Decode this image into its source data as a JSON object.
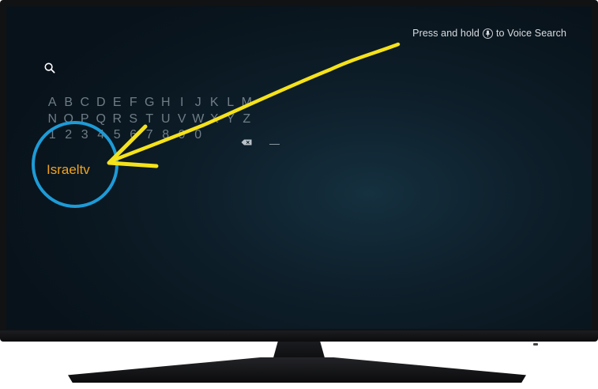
{
  "screen": {
    "voice_hint_prefix": "Press and hold",
    "voice_hint_suffix": "to Voice Search",
    "search_query": "Israeltv"
  },
  "keyboard": {
    "row1": [
      "A",
      "B",
      "C",
      "D",
      "E",
      "F",
      "G",
      "H",
      "I",
      "J",
      "K",
      "L",
      "M"
    ],
    "row2": [
      "N",
      "O",
      "P",
      "Q",
      "R",
      "S",
      "T",
      "U",
      "V",
      "W",
      "X",
      "Y",
      "Z"
    ],
    "row3": [
      "1",
      "2",
      "3",
      "4",
      "5",
      "6",
      "7",
      "8",
      "9",
      "0"
    ]
  },
  "icons": {
    "search": "search-icon",
    "mic": "mic-icon",
    "backspace": "backspace-icon",
    "space": "space-key"
  },
  "annotation": {
    "circle_color": "#1e9bd6",
    "arrow_color": "#f5e21a"
  },
  "colors": {
    "query_text": "#f1a31f",
    "key_text": "#6f7d86"
  }
}
